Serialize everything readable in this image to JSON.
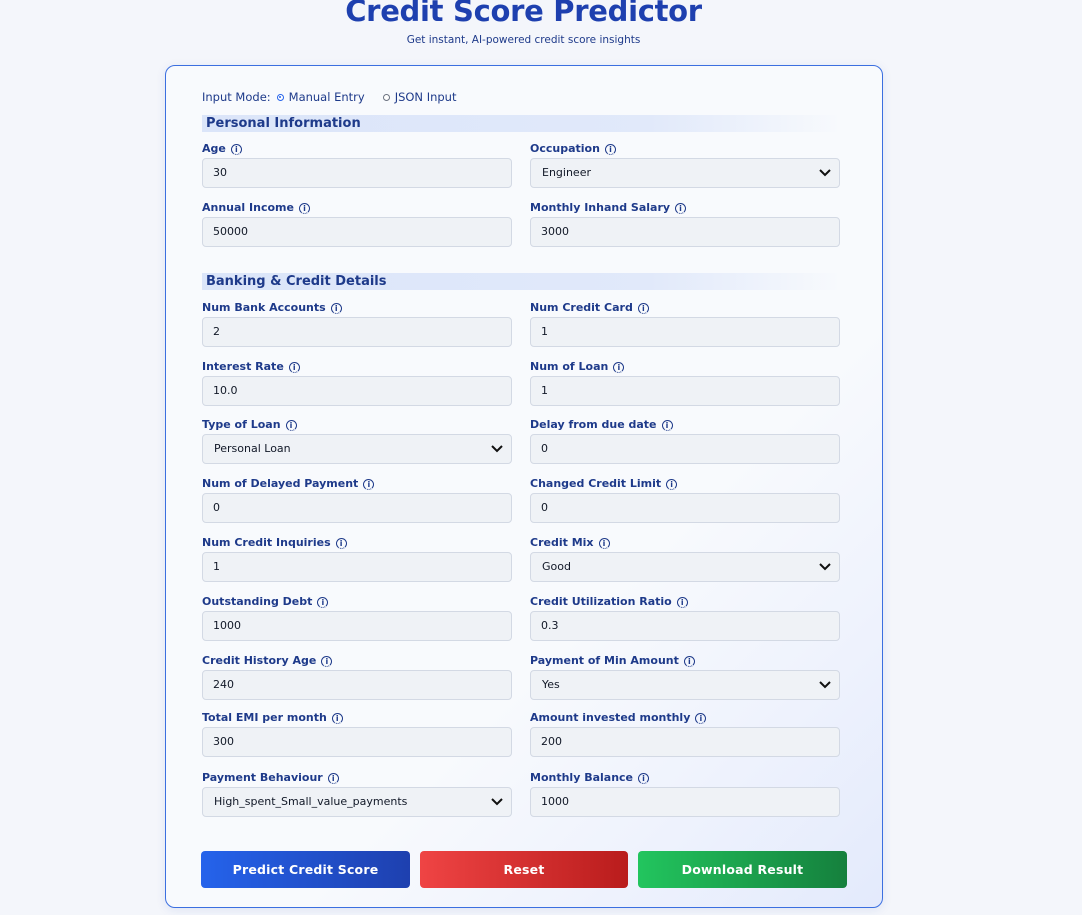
{
  "header": {
    "title": "Credit Score Predictor",
    "subtitle": "Get instant, AI-powered credit score insights"
  },
  "input_mode": {
    "label": "Input Mode:",
    "options": [
      "Manual Entry",
      "JSON Input"
    ],
    "selected": "Manual Entry"
  },
  "sections": {
    "personal": "Personal Information",
    "banking": "Banking & Credit Details"
  },
  "fields": {
    "age": {
      "label": "Age",
      "value": "30"
    },
    "occupation": {
      "label": "Occupation",
      "value": "Engineer"
    },
    "annual_income": {
      "label": "Annual Income",
      "value": "50000"
    },
    "monthly_salary": {
      "label": "Monthly Inhand Salary",
      "value": "3000"
    },
    "num_bank_accounts": {
      "label": "Num Bank Accounts",
      "value": "2"
    },
    "num_credit_card": {
      "label": "Num Credit Card",
      "value": "1"
    },
    "interest_rate": {
      "label": "Interest Rate",
      "value": "10.0"
    },
    "num_of_loan": {
      "label": "Num of Loan",
      "value": "1"
    },
    "type_of_loan": {
      "label": "Type of Loan",
      "value": "Personal Loan"
    },
    "delay_from_due": {
      "label": "Delay from due date",
      "value": "0"
    },
    "num_delayed_payment": {
      "label": "Num of Delayed Payment",
      "value": "0"
    },
    "changed_credit_limit": {
      "label": "Changed Credit Limit",
      "value": "0"
    },
    "num_credit_inquiries": {
      "label": "Num Credit Inquiries",
      "value": "1"
    },
    "credit_mix": {
      "label": "Credit Mix",
      "value": "Good"
    },
    "outstanding_debt": {
      "label": "Outstanding Debt",
      "value": "1000"
    },
    "credit_utilization": {
      "label": "Credit Utilization Ratio",
      "value": "0.3"
    },
    "credit_history_age": {
      "label": "Credit History Age",
      "value": "240"
    },
    "payment_min_amount": {
      "label": "Payment of Min Amount",
      "value": "Yes"
    },
    "total_emi": {
      "label": "Total EMI per month",
      "value": "300"
    },
    "amount_invested": {
      "label": "Amount invested monthly",
      "value": "200"
    },
    "payment_behaviour": {
      "label": "Payment Behaviour",
      "value": "High_spent_Small_value_payments"
    },
    "monthly_balance": {
      "label": "Monthly Balance",
      "value": "1000"
    }
  },
  "buttons": {
    "predict": "Predict Credit Score",
    "reset": "Reset",
    "download": "Download Result"
  },
  "colors": {
    "accent": "#1e40af",
    "predict": "#2563eb",
    "reset": "#ef4444",
    "download": "#22c55e"
  }
}
